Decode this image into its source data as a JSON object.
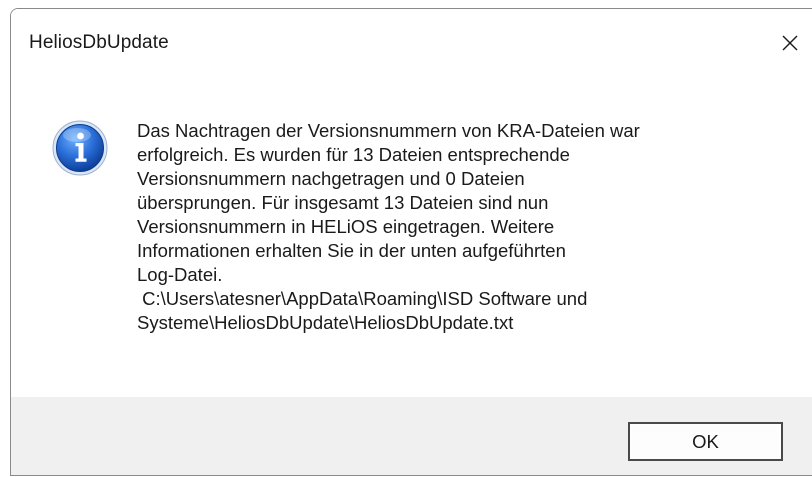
{
  "window": {
    "title": "HeliosDbUpdate",
    "close_icon": "close-icon"
  },
  "content": {
    "icon": "info-icon",
    "message": "Das Nachtragen der Versionsnummern von KRA-Dateien war\nerfolgreich. Es wurden für 13 Dateien entsprechende\nVersionsnummern nachgetragen und 0 Dateien\nübersprungen. Für insgesamt 13 Dateien sind nun\nVersionsnummern in HELiOS eingetragen. Weitere\nInformationen erhalten Sie in der unten aufgeführten\nLog-Datei.\n C:\\Users\\atesner\\AppData\\Roaming\\ISD Software und\nSysteme\\HeliosDbUpdate\\HeliosDbUpdate.txt"
  },
  "footer": {
    "ok_label": "OK"
  },
  "colors": {
    "footer_bg": "#f0f0f0",
    "icon_blue": "#1b5fc7"
  }
}
